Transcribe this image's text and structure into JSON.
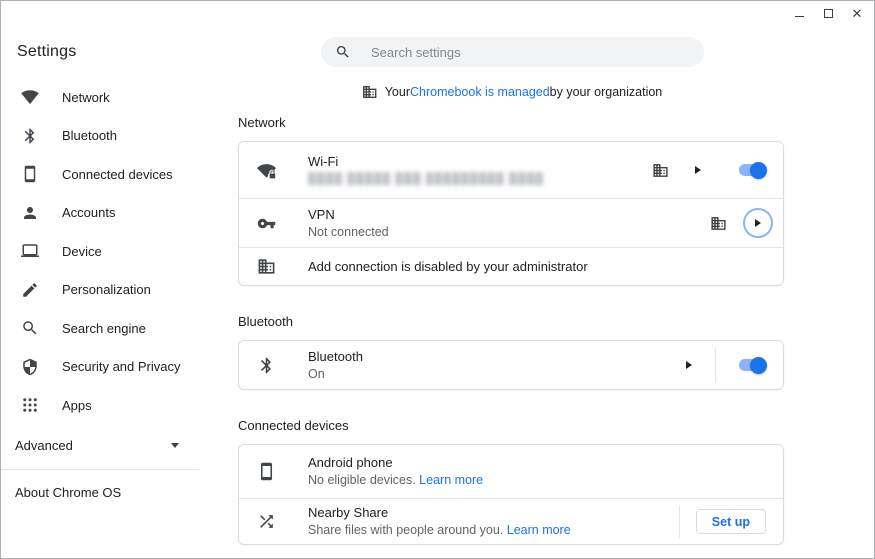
{
  "window": {
    "app_title": "Settings"
  },
  "titlebar": {
    "controls": [
      "minimize",
      "maximize",
      "close"
    ],
    "close_glyph": "✕"
  },
  "sidebar": {
    "items": [
      {
        "label": "Network",
        "icon": "wifi-icon"
      },
      {
        "label": "Bluetooth",
        "icon": "bluetooth-icon"
      },
      {
        "label": "Connected devices",
        "icon": "smartphone-icon"
      },
      {
        "label": "Accounts",
        "icon": "person-icon"
      },
      {
        "label": "Device",
        "icon": "laptop-icon"
      },
      {
        "label": "Personalization",
        "icon": "pen-icon"
      },
      {
        "label": "Search engine",
        "icon": "search-icon"
      },
      {
        "label": "Security and Privacy",
        "icon": "shield-icon"
      },
      {
        "label": "Apps",
        "icon": "apps-icon"
      }
    ],
    "advanced_label": "Advanced",
    "about_label": "About Chrome OS"
  },
  "search": {
    "placeholder": "Search settings"
  },
  "managed_banner": {
    "prefix": "Your ",
    "link": "Chromebook is managed",
    "suffix": " by your organization"
  },
  "sections": {
    "network": {
      "header": "Network",
      "wifi": {
        "title": "Wi-Fi",
        "subtitle_redacted": "████ █████ ███ █████████ ████",
        "toggle_on": true
      },
      "vpn": {
        "title": "VPN",
        "subtitle": "Not connected"
      },
      "add_connection": {
        "text": "Add connection is disabled by your administrator"
      }
    },
    "bluetooth": {
      "header": "Bluetooth",
      "row": {
        "title": "Bluetooth",
        "subtitle": "On",
        "toggle_on": true
      }
    },
    "connected_devices": {
      "header": "Connected devices",
      "android": {
        "title": "Android phone",
        "subtitle": "No eligible devices. ",
        "link": "Learn more"
      },
      "nearby": {
        "title": "Nearby Share",
        "subtitle": "Share files with people around you. ",
        "link": "Learn more",
        "button": "Set up"
      }
    }
  },
  "colors": {
    "accent": "#1a73e8",
    "toggle_track": "#8ab4f8",
    "toggle_knob": "#1a73e8",
    "text_primary": "#202124",
    "text_secondary": "#5f6368",
    "card_border": "#dadce0",
    "search_bg": "#f1f3f4"
  }
}
